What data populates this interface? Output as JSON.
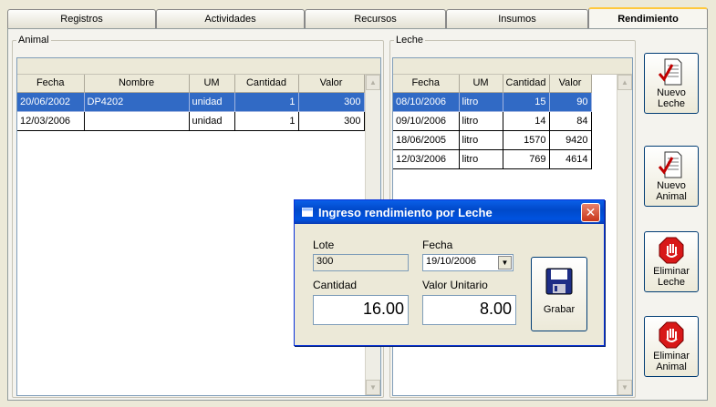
{
  "tabs": [
    {
      "label": "Registros"
    },
    {
      "label": "Actividades"
    },
    {
      "label": "Recursos"
    },
    {
      "label": "Insumos"
    },
    {
      "label": "Rendimiento"
    }
  ],
  "animal": {
    "legend": "Animal",
    "columns": [
      "Fecha",
      "Nombre",
      "UM",
      "Cantidad",
      "Valor"
    ],
    "rows": [
      {
        "fecha": "20/06/2002",
        "nombre": "DP4202",
        "um": "unidad",
        "cantidad": "1",
        "valor": "300"
      },
      {
        "fecha": "12/03/2006",
        "nombre": "",
        "um": "unidad",
        "cantidad": "1",
        "valor": "300"
      }
    ]
  },
  "leche": {
    "legend": "Leche",
    "columns": [
      "Fecha",
      "UM",
      "Cantidad",
      "Valor"
    ],
    "rows": [
      {
        "fecha": "08/10/2006",
        "um": "litro",
        "cantidad": "15",
        "valor": "90"
      },
      {
        "fecha": "09/10/2006",
        "um": "litro",
        "cantidad": "14",
        "valor": "84"
      },
      {
        "fecha": "18/06/2005",
        "um": "litro",
        "cantidad": "1570",
        "valor": "9420"
      },
      {
        "fecha": "12/03/2006",
        "um": "litro",
        "cantidad": "769",
        "valor": "4614"
      }
    ]
  },
  "side_buttons": [
    {
      "line1": "Nuevo",
      "line2": "Leche",
      "icon": "document-check-icon"
    },
    {
      "line1": "Nuevo",
      "line2": "Animal",
      "icon": "document-check-icon"
    },
    {
      "line1": "Eliminar",
      "line2": "Leche",
      "icon": "stop-hand-icon"
    },
    {
      "line1": "Eliminar",
      "line2": "Animal",
      "icon": "stop-hand-icon"
    }
  ],
  "dialog": {
    "title": "Ingreso rendimiento por Leche",
    "close": "✕",
    "lote_label": "Lote",
    "lote_value": "300",
    "fecha_label": "Fecha",
    "fecha_value": "19/10/2006",
    "cantidad_label": "Cantidad",
    "cantidad_value": "16.00",
    "valor_label": "Valor Unitario",
    "valor_value": "8.00",
    "grabar_label": "Grabar"
  },
  "colors": {
    "selection": "#316ac5",
    "titlebar": "#0053e0",
    "close": "#c8361a"
  }
}
